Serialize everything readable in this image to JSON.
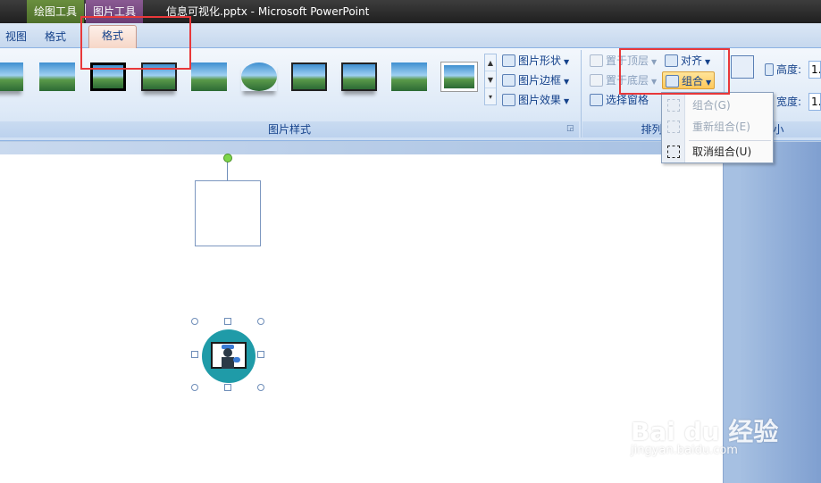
{
  "titlebar": {
    "context_draw": "绘图工具",
    "context_picture": "图片工具",
    "title": "信息可视化.pptx - Microsoft PowerPoint"
  },
  "tabs": [
    {
      "label": "视图"
    },
    {
      "label": "格式"
    },
    {
      "label": "格式"
    }
  ],
  "ribbon": {
    "picture_styles": {
      "label": "图片样式",
      "commands": {
        "shape": "图片形状",
        "border": "图片边框",
        "effects": "图片效果"
      }
    },
    "arrange": {
      "label": "排列",
      "bring_front": "置于顶层",
      "send_back": "置于底层",
      "selection_pane": "选择窗格",
      "align": "对齐",
      "group": "组合"
    },
    "size": {
      "label": "大小",
      "height_label": "高度:",
      "width_label": "宽度:",
      "height_value": "1.",
      "width_value": "1."
    }
  },
  "group_menu": {
    "items": [
      {
        "label": "组合(G)",
        "enabled": false
      },
      {
        "label": "重新组合(E)",
        "enabled": false
      },
      {
        "label": "取消组合(U)",
        "enabled": true
      }
    ]
  },
  "watermark": {
    "brand": "Bai du 经验",
    "url": "jingyan.baidu.com"
  },
  "colors": {
    "highlight": "#e8383a",
    "icon_teal": "#1f9ba8"
  }
}
